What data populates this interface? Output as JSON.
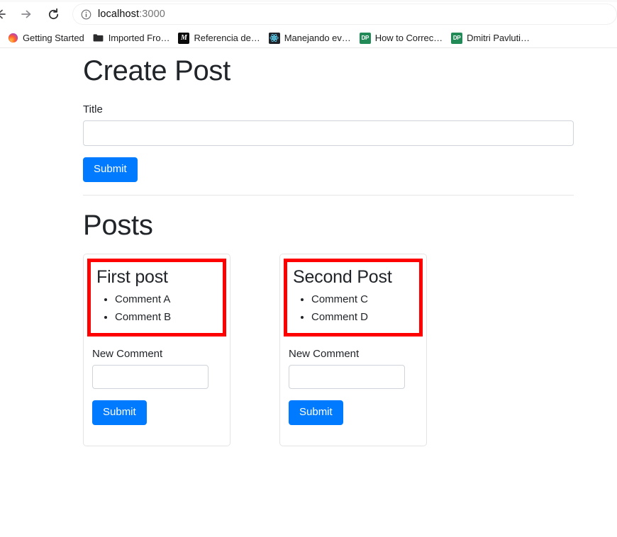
{
  "browser": {
    "back_label": "Back",
    "forward_label": "Forward",
    "reload_label": "Reload",
    "url_host": "localhost",
    "url_port": ":3000",
    "identity_icon": "info-circle-icon",
    "bookmarks": [
      {
        "label": "Getting Started",
        "icon": "firefox-icon",
        "icon_text": ""
      },
      {
        "label": "Imported Fro…",
        "icon": "folder-icon",
        "icon_text": ""
      },
      {
        "label": "Referencia de…",
        "icon": "mdn-icon",
        "icon_text": "M"
      },
      {
        "label": "Manejando ev…",
        "icon": "react-icon",
        "icon_text": ""
      },
      {
        "label": "How to Correc…",
        "icon": "dp-icon",
        "icon_text": "DP"
      },
      {
        "label": "Dmitri Pavluti…",
        "icon": "dp-icon",
        "icon_text": "DP"
      }
    ]
  },
  "page": {
    "create_post": {
      "heading": "Create Post",
      "title_label": "Title",
      "title_value": "",
      "title_placeholder": "",
      "submit_label": "Submit"
    },
    "posts_heading": "Posts",
    "posts": [
      {
        "title": "First post",
        "comments": [
          "Comment A",
          "Comment B"
        ],
        "new_comment_label": "New Comment",
        "new_comment_value": "",
        "new_comment_placeholder": "",
        "submit_label": "Submit",
        "highlighted": true
      },
      {
        "title": "Second Post",
        "comments": [
          "Comment C",
          "Comment D"
        ],
        "new_comment_label": "New Comment",
        "new_comment_value": "",
        "new_comment_placeholder": "",
        "submit_label": "Submit",
        "highlighted": true
      }
    ]
  },
  "colors": {
    "primary_button": "#007bff",
    "highlight_box": "#fe0000",
    "text": "#212529",
    "input_border": "#ced4da",
    "card_border": "#e4e4e4"
  }
}
